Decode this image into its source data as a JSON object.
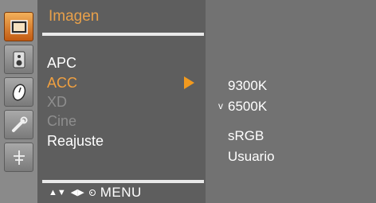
{
  "menu": {
    "title": "Imagen",
    "items": [
      {
        "label": "APC",
        "state": "normal"
      },
      {
        "label": "ACC",
        "state": "selected"
      },
      {
        "label": "XD",
        "state": "disabled"
      },
      {
        "label": "Cine",
        "state": "disabled"
      },
      {
        "label": "Reajuste",
        "state": "normal"
      }
    ]
  },
  "submenu": {
    "items": [
      "9300K",
      "6500K",
      "sRGB",
      "Usuario"
    ],
    "selected_mark": "v"
  },
  "nav": {
    "arrows_up_down": "▲▼",
    "arrows_left_right": "◀▶",
    "menu_label": "MENU"
  },
  "icons": [
    "picture-icon",
    "speaker-icon",
    "clock-icon",
    "wrench-icon",
    "antenna-icon"
  ],
  "colors": {
    "title": "#e8a04a",
    "selected": "#f0a040",
    "disabled": "#8e8e8e",
    "active_icon": "#d9782a"
  }
}
